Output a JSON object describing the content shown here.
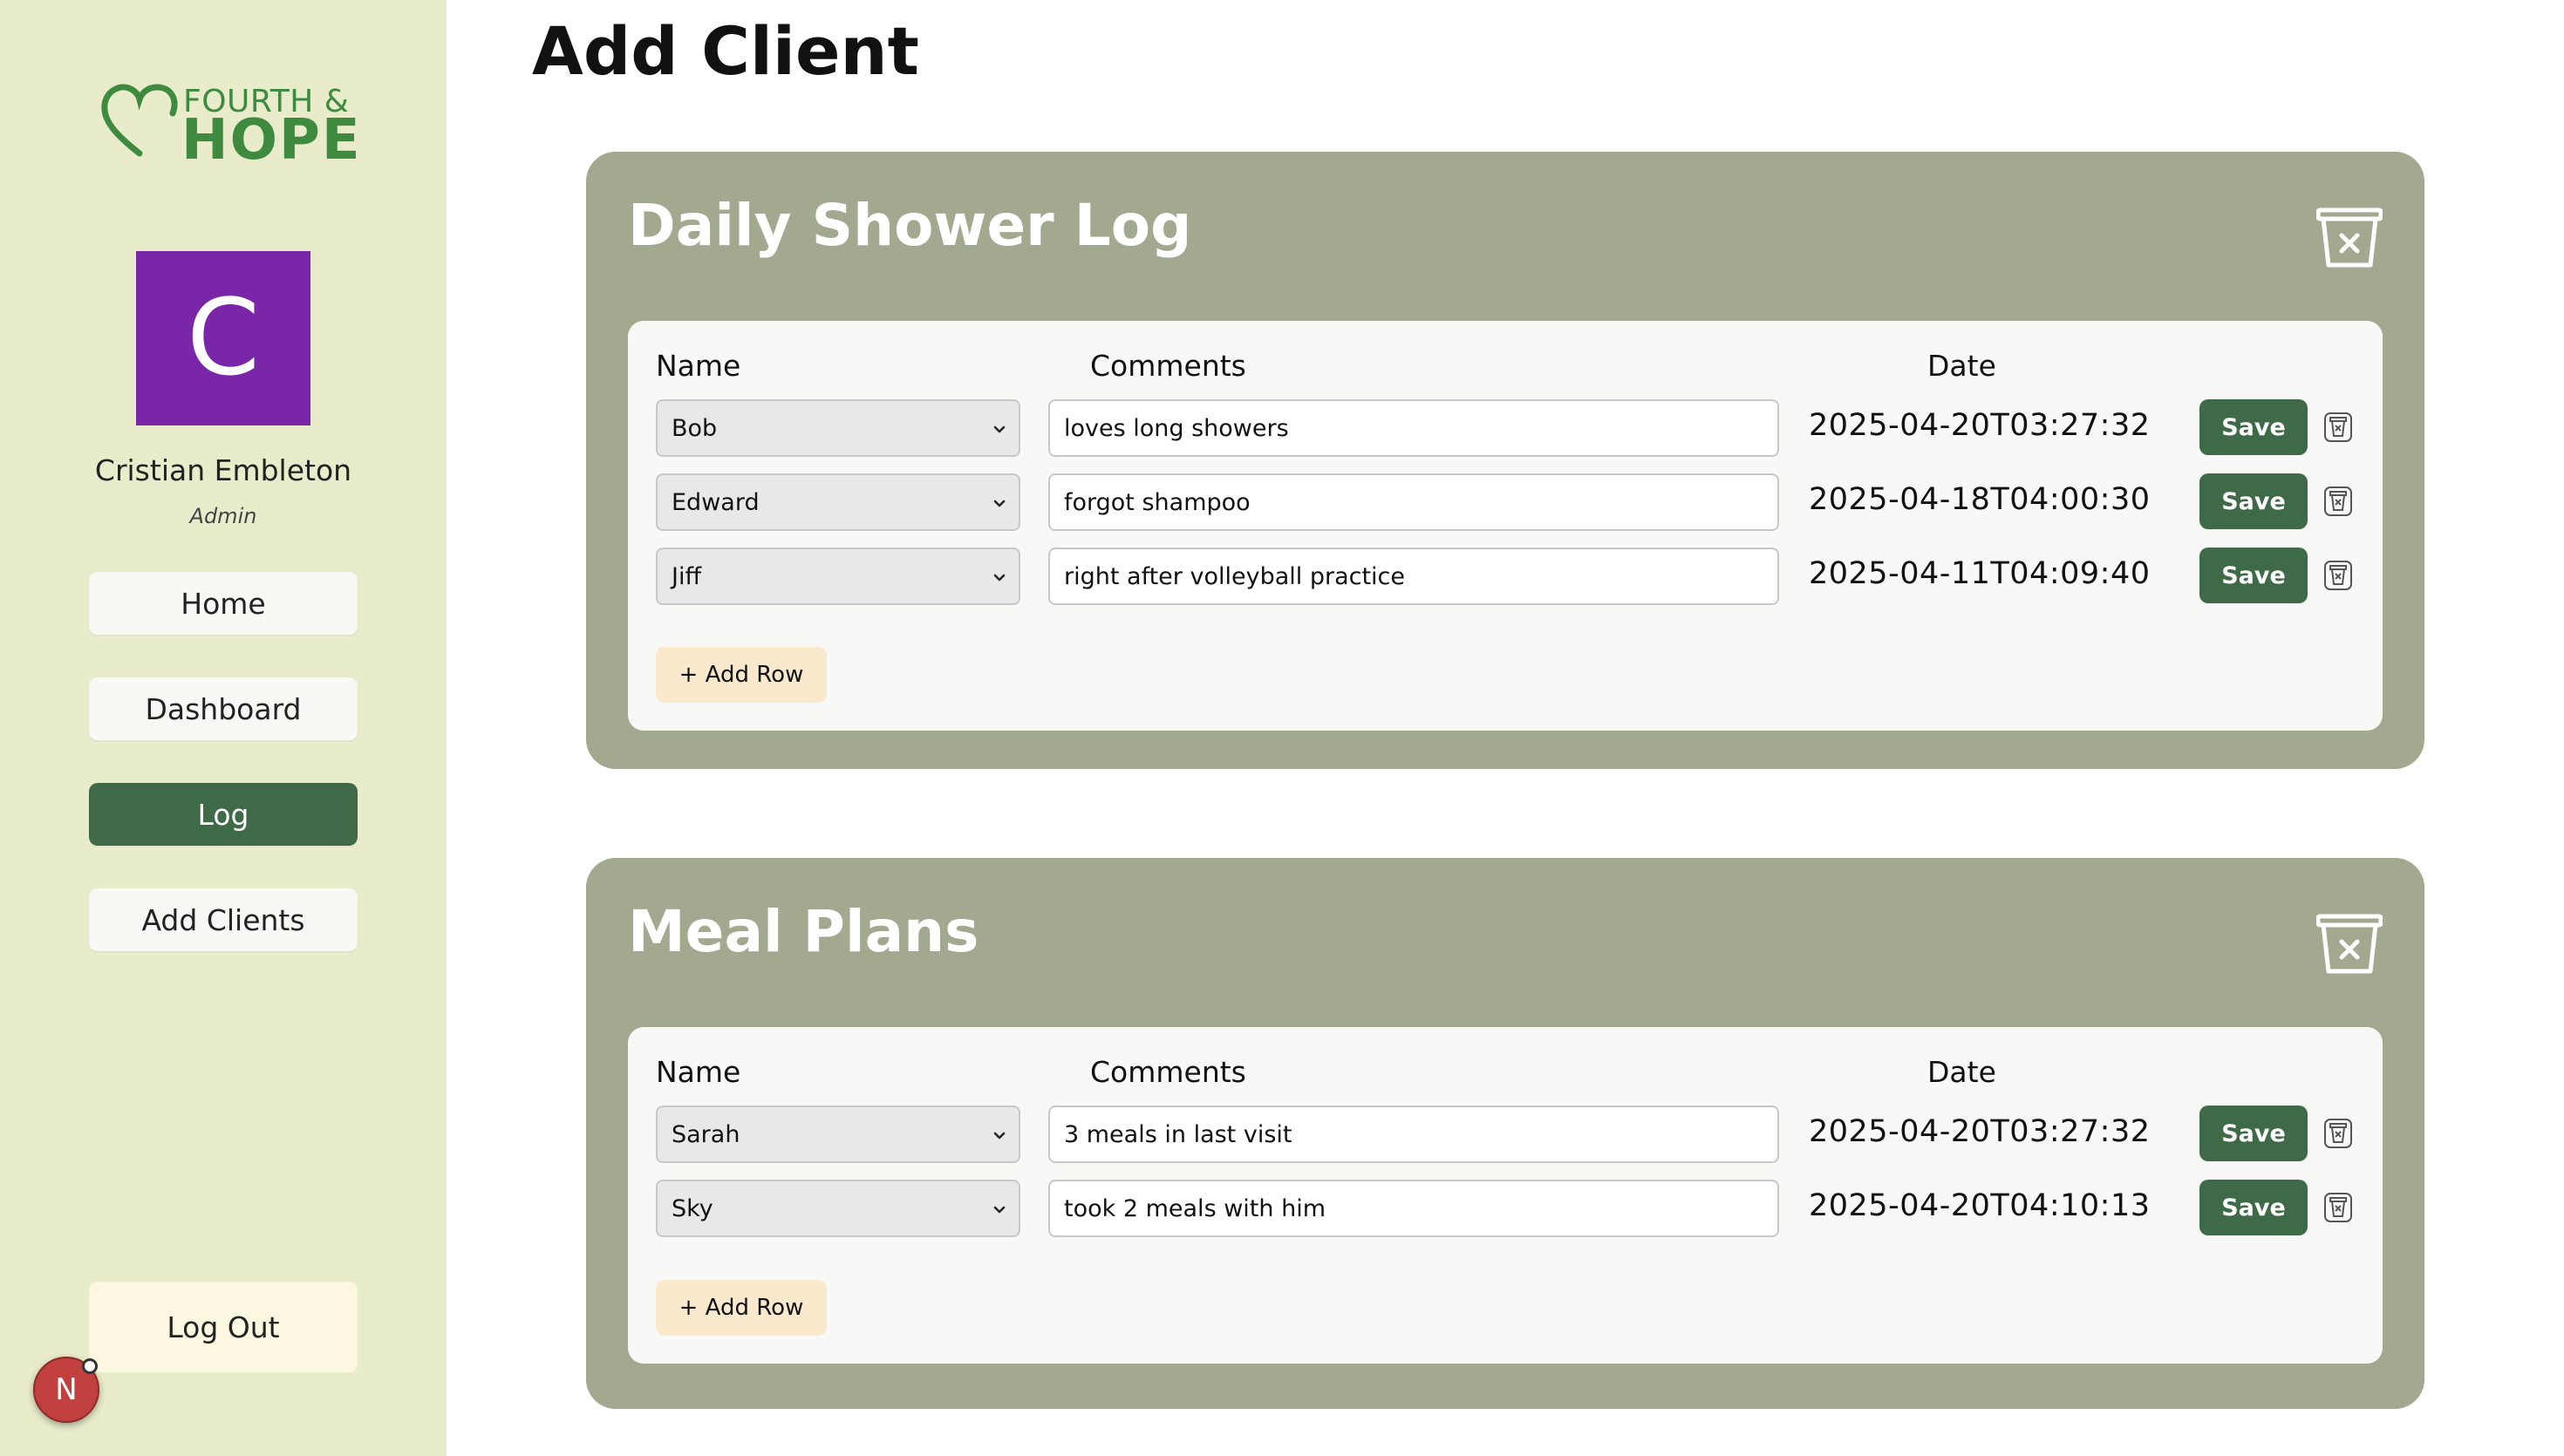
{
  "brand": {
    "line1": "FOURTH &",
    "line2": "HOPE",
    "color": "#3e8a3e"
  },
  "user": {
    "initial": "C",
    "name": "Cristian Embleton",
    "role": "Admin",
    "avatar_color": "#7a26a8"
  },
  "nav": {
    "home": "Home",
    "dashboard": "Dashboard",
    "log": "Log",
    "add_clients": "Add Clients",
    "active": "Log"
  },
  "logout": "Log Out",
  "notification_badge": "N",
  "page_title": "Add Client",
  "columns": {
    "name": "Name",
    "comments": "Comments",
    "date": "Date"
  },
  "buttons": {
    "save": "Save",
    "add_row": "+ Add Row"
  },
  "logs": [
    {
      "title": "Daily Shower Log",
      "rows": [
        {
          "name": "Bob",
          "comment": "loves long showers",
          "date": "2025-04-20T03:27:32"
        },
        {
          "name": "Edward",
          "comment": "forgot shampoo",
          "date": "2025-04-18T04:00:30"
        },
        {
          "name": "Jiff",
          "comment": "right after volleyball practice",
          "date": "2025-04-11T04:09:40"
        }
      ]
    },
    {
      "title": "Meal Plans",
      "rows": [
        {
          "name": "Sarah",
          "comment": "3 meals in last visit",
          "date": "2025-04-20T03:27:32"
        },
        {
          "name": "Sky",
          "comment": "took 2 meals with him",
          "date": "2025-04-20T04:10:13"
        }
      ]
    }
  ],
  "colors": {
    "sidebar_bg": "#e9eccb",
    "card_bg": "#a3a98e",
    "accent_green": "#3e6a48",
    "add_row_bg": "#fbe9cd"
  }
}
